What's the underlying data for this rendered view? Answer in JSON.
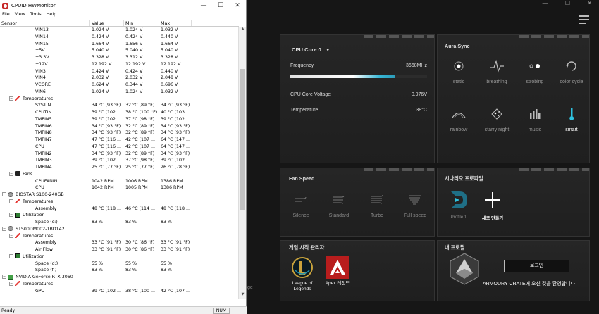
{
  "hwmonitor": {
    "title": "CPUID HWMonitor",
    "window_controls": [
      "—",
      "☐",
      "✕"
    ],
    "menu": [
      "File",
      "View",
      "Tools",
      "Help"
    ],
    "columns": [
      "Sensor",
      "Value",
      "Min",
      "Max"
    ],
    "rows": [
      {
        "depth": 3,
        "name": "VIN13",
        "value": "1.024 V",
        "min": "1.024 V",
        "max": "1.032 V"
      },
      {
        "depth": 3,
        "name": "VIN14",
        "value": "0.424 V",
        "min": "0.424 V",
        "max": "0.440 V"
      },
      {
        "depth": 3,
        "name": "VIN15",
        "value": "1.664 V",
        "min": "1.656 V",
        "max": "1.664 V"
      },
      {
        "depth": 3,
        "name": "+5V",
        "value": "5.040 V",
        "min": "5.040 V",
        "max": "5.040 V"
      },
      {
        "depth": 3,
        "name": "+3.3V",
        "value": "3.328 V",
        "min": "3.312 V",
        "max": "3.328 V"
      },
      {
        "depth": 3,
        "name": "+12V",
        "value": "12.192 V",
        "min": "12.192 V",
        "max": "12.192 V"
      },
      {
        "depth": 3,
        "name": "VIN3",
        "value": "0.424 V",
        "min": "0.424 V",
        "max": "0.440 V"
      },
      {
        "depth": 3,
        "name": "VIN4",
        "value": "2.032 V",
        "min": "2.032 V",
        "max": "2.048 V"
      },
      {
        "depth": 3,
        "name": "VCORE",
        "value": "0.624 V",
        "min": "0.344 V",
        "max": "0.696 V"
      },
      {
        "depth": 3,
        "name": "VIN6",
        "value": "1.024 V",
        "min": "1.024 V",
        "max": "1.032 V"
      },
      {
        "depth": 2,
        "group": "temp",
        "name": "Temperatures",
        "value": "",
        "min": "",
        "max": ""
      },
      {
        "depth": 3,
        "name": "SYSTIN",
        "value": "34 °C  (93 °F)",
        "min": "32 °C  (89 °F)",
        "max": "34 °C  (93 °F)"
      },
      {
        "depth": 3,
        "name": "CPUTIN",
        "value": "39 °C  (102 ...",
        "min": "38 °C  (100 °F)",
        "max": "40 °C  (103 ..."
      },
      {
        "depth": 3,
        "name": "TMPIN5",
        "value": "39 °C  (102 ...",
        "min": "37 °C  (98 °F)",
        "max": "39 °C  (102 ..."
      },
      {
        "depth": 3,
        "name": "TMPIN6",
        "value": "34 °C  (93 °F)",
        "min": "32 °C  (89 °F)",
        "max": "34 °C  (93 °F)"
      },
      {
        "depth": 3,
        "name": "TMPIN8",
        "value": "34 °C  (93 °F)",
        "min": "32 °C  (89 °F)",
        "max": "34 °C  (93 °F)"
      },
      {
        "depth": 3,
        "name": "TMPIN7",
        "value": "47 °C  (116 ...",
        "min": "42 °C  (107 ...",
        "max": "64 °C  (147 ..."
      },
      {
        "depth": 3,
        "name": "CPU",
        "value": "47 °C  (116 ...",
        "min": "42 °C  (107 ...",
        "max": "64 °C  (147 ..."
      },
      {
        "depth": 3,
        "name": "TMPIN2",
        "value": "34 °C  (93 °F)",
        "min": "32 °C  (89 °F)",
        "max": "34 °C  (93 °F)"
      },
      {
        "depth": 3,
        "name": "TMPIN3",
        "value": "39 °C  (102 ...",
        "min": "37 °C  (98 °F)",
        "max": "39 °C  (102 ..."
      },
      {
        "depth": 3,
        "name": "TMPIN4",
        "value": "25 °C  (77 °F)",
        "min": "25 °C  (77 °F)",
        "max": "26 °C  (78 °F)"
      },
      {
        "depth": 2,
        "group": "fan",
        "name": "Fans",
        "value": "",
        "min": "",
        "max": ""
      },
      {
        "depth": 3,
        "name": "CPUFANIN",
        "value": "1042 RPM",
        "min": "1006 RPM",
        "max": "1386 RPM"
      },
      {
        "depth": 3,
        "name": "CPU",
        "value": "1042 RPM",
        "min": "1005 RPM",
        "max": "1386 RPM"
      },
      {
        "depth": 1,
        "group": "disk",
        "name": "BIOSTAR S100-240GB",
        "value": "",
        "min": "",
        "max": ""
      },
      {
        "depth": 2,
        "group": "temp",
        "name": "Temperatures",
        "value": "",
        "min": "",
        "max": ""
      },
      {
        "depth": 3,
        "name": "Assembly",
        "value": "48 °C  (118 ...",
        "min": "46 °C  (114 ...",
        "max": "48 °C  (118 ..."
      },
      {
        "depth": 2,
        "group": "util",
        "name": "Utilization",
        "value": "",
        "min": "",
        "max": ""
      },
      {
        "depth": 3,
        "name": "Space (c:)",
        "value": "83 %",
        "min": "83 %",
        "max": "83 %"
      },
      {
        "depth": 1,
        "group": "disk",
        "name": "ST500DM002-1BD142",
        "value": "",
        "min": "",
        "max": ""
      },
      {
        "depth": 2,
        "group": "temp",
        "name": "Temperatures",
        "value": "",
        "min": "",
        "max": ""
      },
      {
        "depth": 3,
        "name": "Assembly",
        "value": "33 °C  (91 °F)",
        "min": "30 °C  (86 °F)",
        "max": "33 °C  (91 °F)"
      },
      {
        "depth": 3,
        "name": "Air Flow",
        "value": "33 °C  (91 °F)",
        "min": "30 °C  (86 °F)",
        "max": "33 °C  (91 °F)"
      },
      {
        "depth": 2,
        "group": "util",
        "name": "Utilization",
        "value": "",
        "min": "",
        "max": ""
      },
      {
        "depth": 3,
        "name": "Space (d:)",
        "value": "55 %",
        "min": "55 %",
        "max": "55 %"
      },
      {
        "depth": 3,
        "name": "Space (f:)",
        "value": "83 %",
        "min": "83 %",
        "max": "83 %"
      },
      {
        "depth": 1,
        "group": "gpu",
        "name": "NVIDIA GeForce RTX 3060",
        "value": "",
        "min": "",
        "max": ""
      },
      {
        "depth": 2,
        "group": "temp",
        "name": "Temperatures",
        "value": "",
        "min": "",
        "max": ""
      },
      {
        "depth": 3,
        "name": "GPU",
        "value": "39 °C  (102 ...",
        "min": "38 °C  (100 ...",
        "max": "42 °C  (107 ..."
      }
    ],
    "status": "Ready",
    "num_indicator": "NUM"
  },
  "armoury": {
    "window_controls": [
      "—",
      "☐",
      "✕"
    ],
    "edge_text": "ge",
    "cpu": {
      "selector": "CPU Core 0",
      "frequency_label": "Frequency",
      "frequency_value": "3668MHz",
      "frequency_fraction": 0.77,
      "voltage_label": "CPU Core Voltage",
      "voltage_value": "0.976V",
      "temp_label": "Temperature",
      "temp_value": "38°C"
    },
    "aura": {
      "title": "Aura Sync",
      "items": [
        {
          "label": "static",
          "icon": "static-icon",
          "active": false
        },
        {
          "label": "breathing",
          "icon": "breathing-icon",
          "active": false
        },
        {
          "label": "strobing",
          "icon": "strobing-icon",
          "active": false
        },
        {
          "label": "color cycle",
          "icon": "color-cycle-icon",
          "active": false
        },
        {
          "label": "rainbow",
          "icon": "rainbow-icon",
          "active": false
        },
        {
          "label": "starry night",
          "icon": "starry-night-icon",
          "active": false
        },
        {
          "label": "music",
          "icon": "music-icon",
          "active": false
        },
        {
          "label": "smart",
          "icon": "smart-icon",
          "active": true
        }
      ],
      "smart_color": "#2fc3e0"
    },
    "fan": {
      "title": "Fan Speed",
      "modes": [
        "Silence",
        "Standard",
        "Turbo",
        "Full speed"
      ]
    },
    "scenario": {
      "title": "시나리오 프로파일",
      "profile1": "Profile 1",
      "add_label": "새로 만들기"
    },
    "game": {
      "title": "게임 시작 관리자",
      "items": [
        {
          "label1": "League of",
          "label2": "Legends",
          "icon": "league-of-legends-icon"
        },
        {
          "label1": "Apex 레전드",
          "label2": "",
          "icon": "apex-legends-icon"
        }
      ]
    },
    "profile": {
      "title": "내 프로필",
      "login": "로그인",
      "welcome": "ARMOURY CRATE에 오신 것을 환영합니다"
    }
  }
}
